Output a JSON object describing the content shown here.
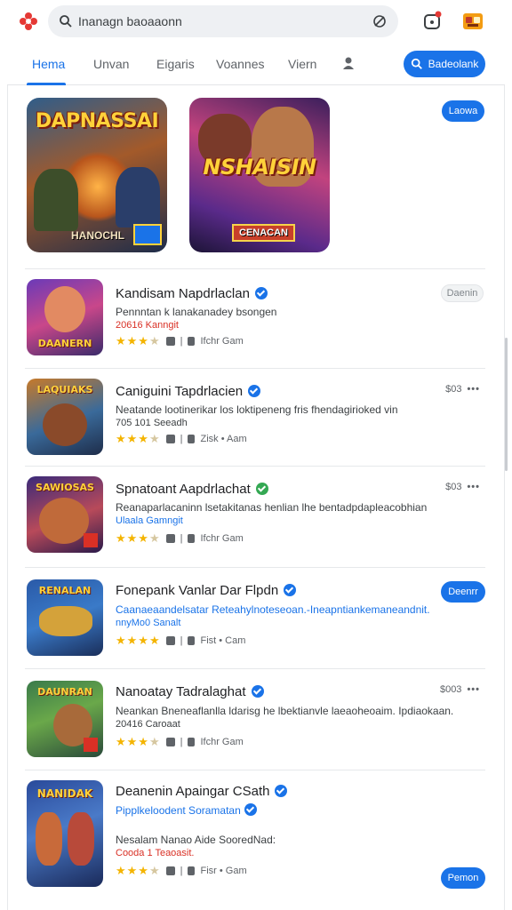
{
  "header": {
    "search_placeholder": "Inanagn baoaaonn",
    "icons": {
      "logo": "pinwheel-logo",
      "search": "search-icon",
      "voice": "voice-search-icon",
      "notifications": "notification-icon",
      "games": "gamepad-icon"
    }
  },
  "nav": {
    "tabs": [
      {
        "label": "Hema",
        "active": true
      },
      {
        "label": "Unvan",
        "active": false
      },
      {
        "label": "Eigaris",
        "active": false
      },
      {
        "label": "Voannes",
        "active": false
      },
      {
        "label": "Viern",
        "active": false
      }
    ],
    "action_label": "Badeolank"
  },
  "featured": {
    "cards": [
      {
        "title": "DAPNASSAI",
        "badge": "HANOCHL"
      },
      {
        "title": "NSHAISIN",
        "badge": "CENACAN"
      }
    ],
    "button_label": "Laowa"
  },
  "apps": [
    {
      "name": "Kandisam Napdrlaclan",
      "desc": "Pennntan k lanakanadey bsongen",
      "sub": "20616 Kanngit",
      "sub_color": "red",
      "rating_stars": 3.5,
      "meta": "Ifchr Gam",
      "action": {
        "type": "button",
        "label": "Daenin"
      },
      "icon_title": "DAANERN",
      "verified_color": "blue"
    },
    {
      "name": "Caniguini Tapdrlacien",
      "desc": "Neatande lootinerikar los loktipeneng fris fhendagirioked vin",
      "sub": "705 101 Seeadh",
      "sub_color": "dark",
      "rating_stars": 3.5,
      "meta": "Zisk • Aam",
      "action": {
        "type": "price",
        "label": "$03"
      },
      "icon_title": "LAQUIAKS",
      "verified_color": "blue"
    },
    {
      "name": "Spnatoant Aapdrlachat",
      "desc": "Reanaparlacaninn lsetakitanas henlian lhe bentadpdapleacobhian",
      "sub": "Ulaala Gamngit",
      "sub_color": "blue",
      "rating_stars": 3.5,
      "meta": "Ifchr Gam",
      "action": {
        "type": "price",
        "label": "$03"
      },
      "icon_title": "SAWIOSAS",
      "verified_color": "green"
    },
    {
      "name": "Fonepank Vanlar Dar Flpdn",
      "desc": "Caanaeaandelsatar Reteahylnoteseoan.-Ineapntiankemaneandnit.",
      "sub": "nnyMo0 Sanalt",
      "sub_color": "blue",
      "rating_stars": 4,
      "meta": "Fist • Cam",
      "action": {
        "type": "button",
        "label": "Deenrr"
      },
      "icon_title": "RENALAN",
      "verified_color": "blue",
      "desc_blue": true
    },
    {
      "name": "Nanoatay Tadralaghat",
      "desc": "Neankan Bneneaflanlla ldarisg he lbektianvle laeaoheoaim. Ipdiaokaan.",
      "sub": "20416 Caroaat",
      "sub_color": "dark",
      "rating_stars": 3.5,
      "meta": "Ifchr Gam",
      "action": {
        "type": "price",
        "label": "$003"
      },
      "icon_title": "DAUNRAN",
      "verified_color": "blue"
    },
    {
      "name": "Deanenin Apaingar CSath",
      "desc": "Pipplkeloodent Soramatan",
      "sub": "Nesalam Nanao Aide SooredNad:",
      "sub2": "Cooda 1 Teaoasit.",
      "sub_color": "dark",
      "rating_stars": 3.5,
      "meta": "Fisr • Gam",
      "action": {
        "type": "button",
        "label": "Pemon"
      },
      "icon_title": "NANIDAK",
      "verified_color": "blue",
      "desc_blue": true
    }
  ],
  "colors": {
    "accent": "#1a73e8",
    "star": "#f4b400",
    "verified_green": "#34a853",
    "error_red": "#d93025"
  }
}
